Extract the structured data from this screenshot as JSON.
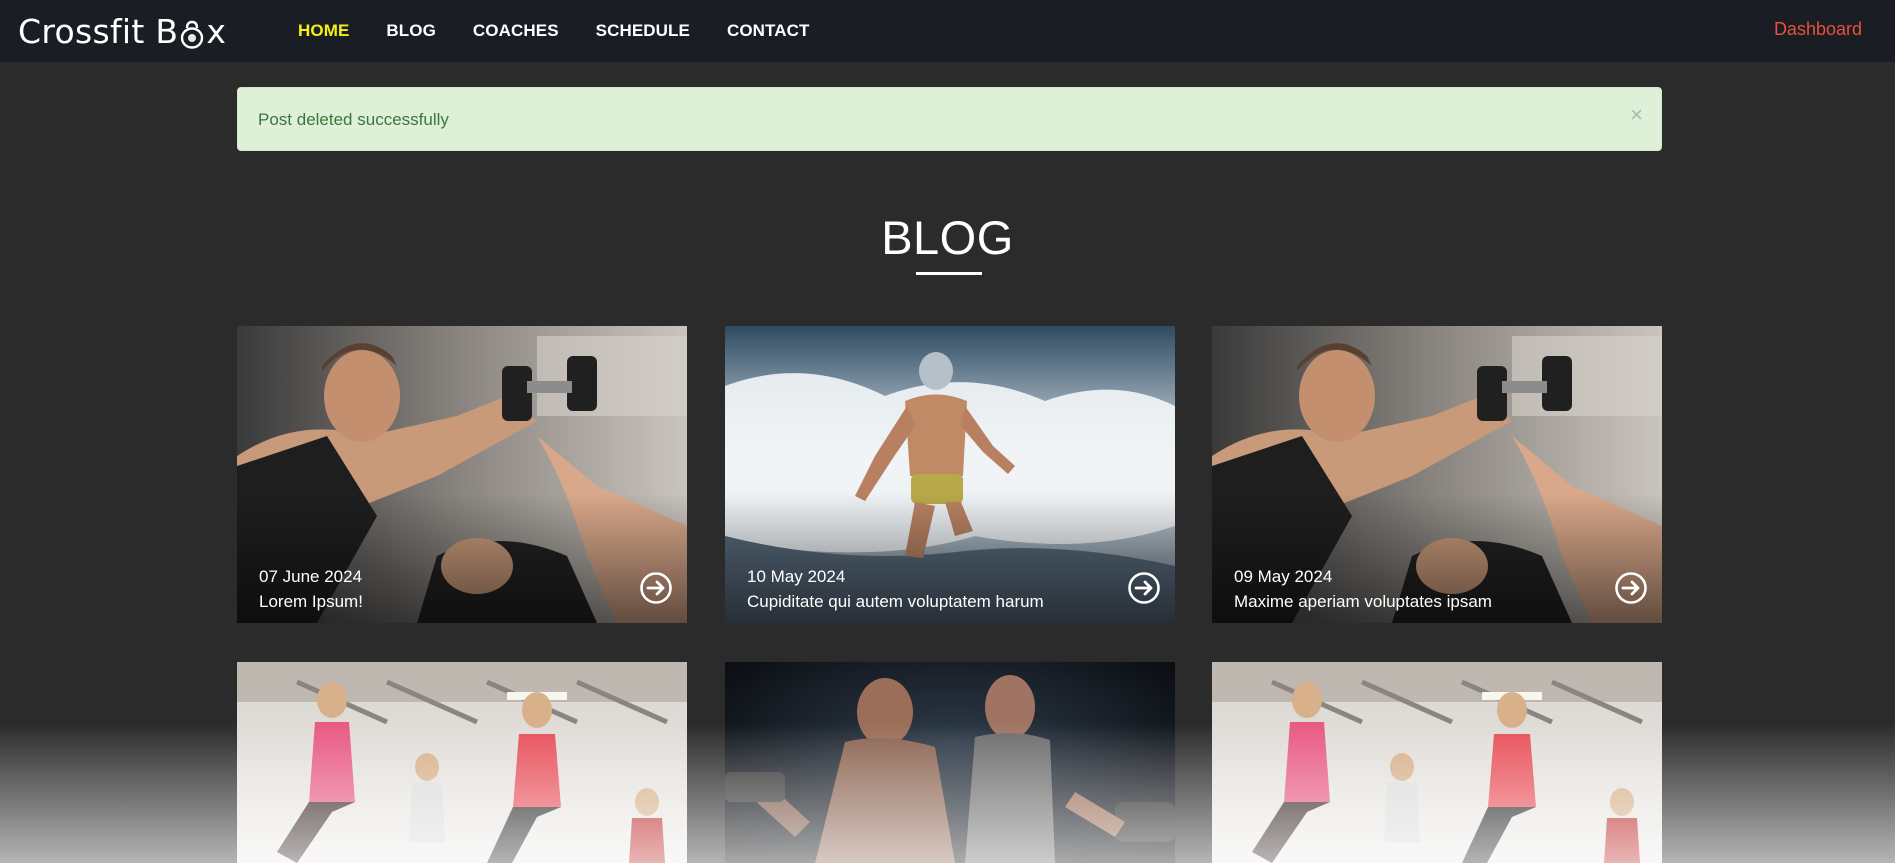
{
  "brand": {
    "logo_text_before": "Crossfit B",
    "logo_text_after": "x"
  },
  "nav": {
    "items": [
      {
        "label": "HOME",
        "active": true
      },
      {
        "label": "BLOG",
        "active": false
      },
      {
        "label": "COACHES",
        "active": false
      },
      {
        "label": "SCHEDULE",
        "active": false
      },
      {
        "label": "CONTACT",
        "active": false
      }
    ],
    "dashboard_label": "Dashboard"
  },
  "alert": {
    "message": "Post deleted successfully",
    "close_label": "×"
  },
  "section": {
    "heading": "BLOG"
  },
  "posts": [
    {
      "date": "07 June 2024",
      "title": "Lorem Ipsum!",
      "image": "gym-trainer-dumbbell"
    },
    {
      "date": "10 May 2024",
      "title": "Cupiditate qui autem voluptatem harum",
      "image": "athlete-running-surf"
    },
    {
      "date": "09 May 2024",
      "title": "Maxime aperiam voluptates ipsam",
      "image": "gym-trainer-dumbbell"
    },
    {
      "date": "",
      "title": "",
      "image": "fitness-class-lunges"
    },
    {
      "date": "",
      "title": "",
      "image": "couple-dumbbells-dark"
    },
    {
      "date": "",
      "title": "",
      "image": "fitness-class-lunges"
    }
  ],
  "colors": {
    "nav_bg": "#1b1d25",
    "page_bg": "#2b2b2b",
    "nav_active": "#f4f112",
    "dashboard_link": "#e8503a",
    "alert_bg": "#dff0d8",
    "alert_text": "#3c763d"
  }
}
